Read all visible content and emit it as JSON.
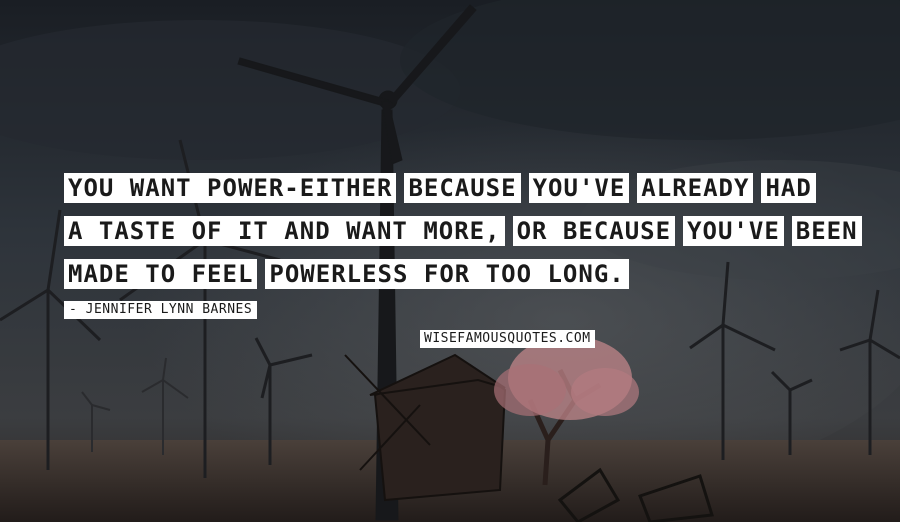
{
  "quote": {
    "line1": [
      "YOU WANT POWER-EITHER",
      "BECAUSE",
      "YOU'VE",
      "ALREADY",
      "HAD"
    ],
    "line2": [
      "A TASTE OF IT AND WANT MORE,",
      "OR BECAUSE",
      "YOU'VE",
      "BEEN"
    ],
    "line3": [
      "MADE TO FEEL",
      "POWERLESS FOR TOO LONG."
    ]
  },
  "author": "- JENNIFER LYNN BARNES",
  "site": "WISEFAMOUSQUOTES.COM",
  "colors": {
    "sky": "#2b3036",
    "ground": "#3a302c",
    "label_bg": "#ffffff",
    "label_text": "#1a1a1a",
    "tree_blossom": "#c0868a"
  }
}
